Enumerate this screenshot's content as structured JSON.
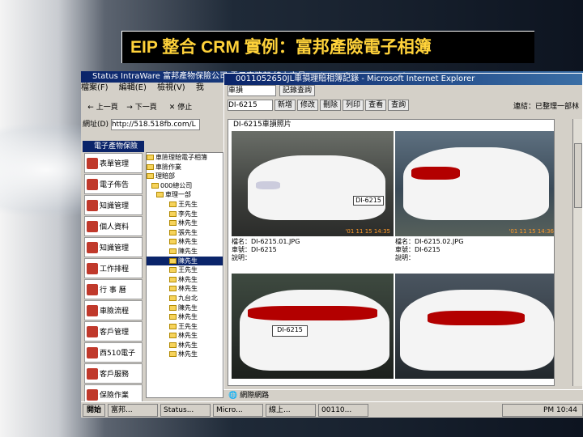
{
  "slide": {
    "title": "EIP 整合 CRM 實例：富邦產險電子相簿"
  },
  "outer_window": {
    "title": "Status IntraWare 富邦產物保險公司 電子商務部 線上交易 - Microsoft Internet Explorer",
    "menu": [
      "檔案(F)",
      "編輯(E)",
      "檢視(V)",
      "我"
    ],
    "toolbar": [
      "上一頁",
      "下一頁",
      "停止"
    ],
    "address_label": "網址(D)",
    "address_value": "http://518.518fb.com/L"
  },
  "sidebar": {
    "header": "電子產物保險",
    "items": [
      "表單管理",
      "電子佈告",
      "知識管理",
      "個人資料",
      "知識管理",
      "工作排程",
      "行 事 曆",
      "車險流程",
      "客戶管理",
      "西510電子",
      "客戶服務",
      "保險作業"
    ]
  },
  "tree": {
    "items": [
      "車險理賠電子相簿",
      "車險作業",
      "理賠部",
      "000總公司",
      "車理一部",
      "王先生",
      "李先生",
      "林先生",
      "張先生",
      "林先生",
      "陳先生",
      "陳先生",
      "王先生",
      "林先生",
      "林先生",
      "九台北",
      "陳先生",
      "林先生",
      "王先生",
      "林先生",
      "林先生",
      "林先生"
    ]
  },
  "ie_window": {
    "title": "0011052650JL車損理賠相簿記錄 - Microsoft Internet Explorer",
    "search_select": "車損",
    "search_button": "記錄查詢",
    "record_select": "DI-6215",
    "tabs": [
      "新增",
      "修改",
      "刪除",
      "列印",
      "查看",
      "查詢"
    ],
    "link_text": "連結：已整理一部林",
    "album_title": "DI-6215車損照片",
    "photos": [
      {
        "filename": "檔名：DI-6215.01.JPG",
        "plate_label": "車號：DI-6215",
        "note": "說明：",
        "plate": "DI-6215",
        "stamp": "'01 11 15 14:35"
      },
      {
        "filename": "檔名：DI-6215.02.JPG",
        "plate_label": "車號：DI-6215",
        "note": "說明：",
        "plate": "",
        "stamp": "'01 11 15 14:36"
      },
      {
        "filename": "",
        "plate_label": "",
        "note": "",
        "plate": "DI-6215",
        "stamp": ""
      },
      {
        "filename": "",
        "plate_label": "",
        "note": "",
        "plate": "",
        "stamp": ""
      }
    ],
    "status": "網際網路"
  },
  "taskbar": {
    "start": "開始",
    "tasks": [
      "富邦...",
      "Status...",
      "Micro...",
      "線上...",
      "00110..."
    ],
    "clock": "PM 10:44"
  }
}
